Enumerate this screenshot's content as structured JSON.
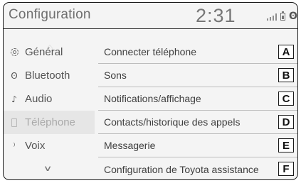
{
  "header": {
    "title": "Configuration",
    "clock": "2:31",
    "status_icons": [
      "signal-icon",
      "battery-icon",
      "bluetooth-icon"
    ],
    "bluetooth_glyph": "ʘ"
  },
  "sidebar": {
    "items": [
      {
        "label": "Général",
        "icon": "gear-icon",
        "selected": false
      },
      {
        "label": "Bluetooth",
        "icon": "bluetooth-icon",
        "selected": false
      },
      {
        "label": "Audio",
        "icon": "music-note-icon",
        "selected": false
      },
      {
        "label": "Téléphone",
        "icon": "phone-icon",
        "selected": true
      },
      {
        "label": "Voix",
        "icon": "voice-icon",
        "selected": false
      }
    ],
    "more_icon": "chevron-down-icon"
  },
  "main": {
    "rows": [
      {
        "label": "Connecter téléphone",
        "badge": "A"
      },
      {
        "label": "Sons",
        "badge": "B"
      },
      {
        "label": "Notifications/affichage",
        "badge": "C"
      },
      {
        "label": "Contacts/historique des appels",
        "badge": "D"
      },
      {
        "label": "Messagerie",
        "badge": "E"
      },
      {
        "label": "Configuration de Toyota assistance",
        "badge": "F"
      }
    ]
  },
  "colors": {
    "background": "#f4f4f4",
    "text": "#3e3e3e",
    "selected_bg": "#e6e6e6",
    "border": "#1c1c1c"
  }
}
